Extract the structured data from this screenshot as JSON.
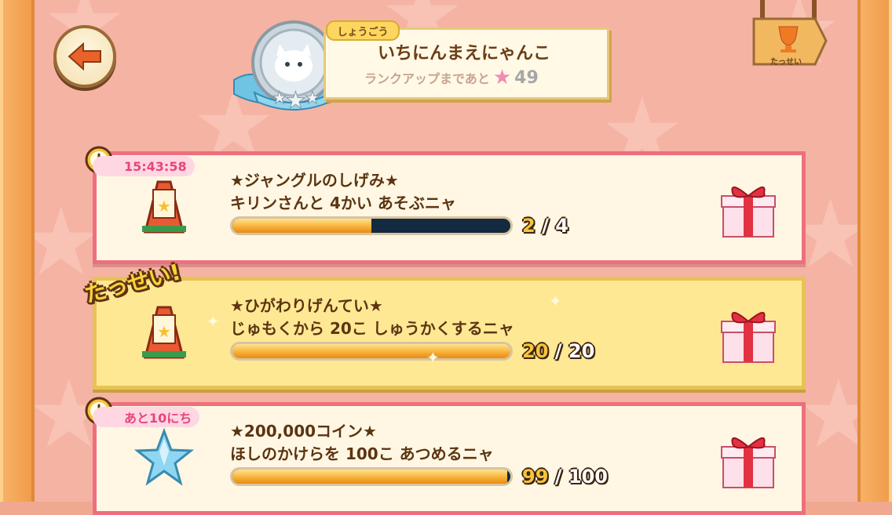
{
  "header": {
    "title_tag": "しょうごう",
    "title": "いちにんまえにゃんこ",
    "rank_up_prefix": "ランクアップまであと",
    "rank_up_remaining": "49",
    "achievements_label": "たっせい"
  },
  "missions": [
    {
      "timer": "15:43:58",
      "title": "★ジャングルのしげみ★",
      "description": "キリンさんと 4かい あそぶニャ",
      "current": "2",
      "separator": "/",
      "total": "4",
      "progress": 0.5,
      "icon": "signboard-icon",
      "reward": "gift-box-icon"
    },
    {
      "badge": "たっせい!",
      "title": "★ひがわりげんてい★",
      "description": "じゅもくから 20こ しゅうかくするニャ",
      "current": "20",
      "separator": "/",
      "total": "20",
      "progress": 1.0,
      "icon": "signboard-icon",
      "reward": "gift-box-icon"
    },
    {
      "timer": "あと10にち",
      "title": "★200,000コイン★",
      "description": "ほしのかけらを 100こ あつめるニャ",
      "current": "99",
      "separator": "/",
      "total": "100",
      "progress": 0.99,
      "icon": "blue-star-icon",
      "reward": "gift-box-icon"
    }
  ],
  "colors": {
    "card_border": "#ee6f7d",
    "card_done_bg": "#ffe893",
    "progress_fill": "#f8b23a",
    "progress_track": "#142a40",
    "text_brown": "#5c3412"
  }
}
